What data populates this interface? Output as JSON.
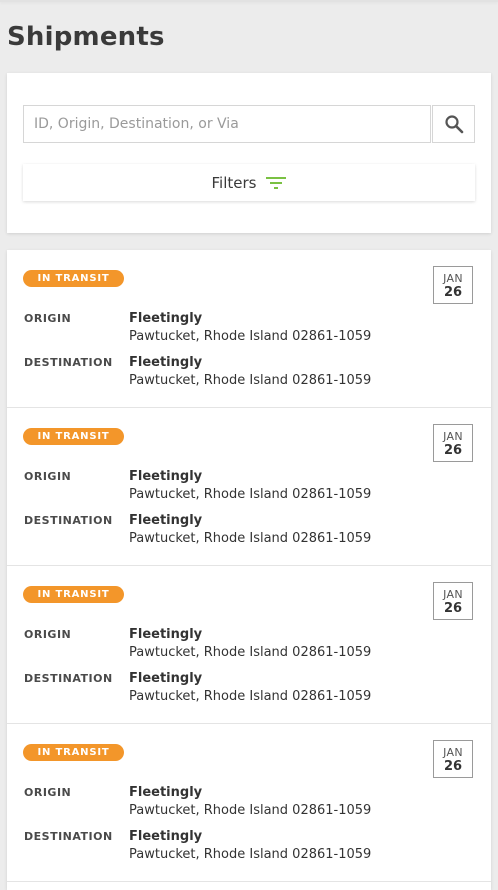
{
  "page": {
    "title": "Shipments"
  },
  "search": {
    "placeholder": "ID, Origin, Destination, or Via",
    "value": "",
    "icon": "search-icon"
  },
  "filters": {
    "label": "Filters",
    "icon": "filter-icon",
    "icon_color": "#7ac143"
  },
  "colors": {
    "status_in_transit": "#f3962a",
    "background": "#ececec",
    "card": "#ffffff"
  },
  "labels": {
    "origin": "ORIGIN",
    "destination": "DESTINATION"
  },
  "shipments": [
    {
      "status": "IN TRANSIT",
      "date": {
        "month": "JAN",
        "day": "26"
      },
      "origin": {
        "name": "Fleetingly",
        "address": "Pawtucket, Rhode Island 02861-1059"
      },
      "destination": {
        "name": "Fleetingly",
        "address": "Pawtucket, Rhode Island 02861-1059"
      }
    },
    {
      "status": "IN TRANSIT",
      "date": {
        "month": "JAN",
        "day": "26"
      },
      "origin": {
        "name": "Fleetingly",
        "address": "Pawtucket, Rhode Island 02861-1059"
      },
      "destination": {
        "name": "Fleetingly",
        "address": "Pawtucket, Rhode Island 02861-1059"
      }
    },
    {
      "status": "IN TRANSIT",
      "date": {
        "month": "JAN",
        "day": "26"
      },
      "origin": {
        "name": "Fleetingly",
        "address": "Pawtucket, Rhode Island 02861-1059"
      },
      "destination": {
        "name": "Fleetingly",
        "address": "Pawtucket, Rhode Island 02861-1059"
      }
    },
    {
      "status": "IN TRANSIT",
      "date": {
        "month": "JAN",
        "day": "26"
      },
      "origin": {
        "name": "Fleetingly",
        "address": "Pawtucket, Rhode Island 02861-1059"
      },
      "destination": {
        "name": "Fleetingly",
        "address": "Pawtucket, Rhode Island 02861-1059"
      }
    }
  ]
}
